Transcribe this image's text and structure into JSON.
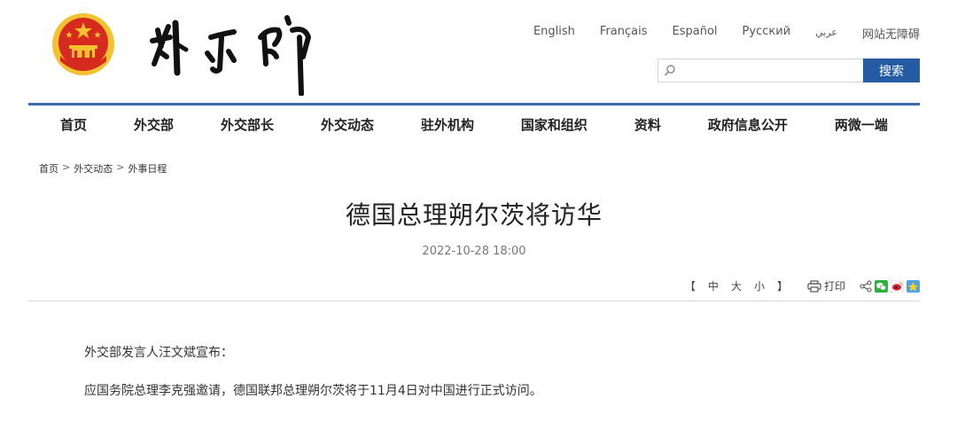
{
  "header": {
    "languages": [
      "English",
      "Français",
      "Español",
      "Русский",
      "عربي",
      "网站无障碍"
    ],
    "search": {
      "placeholder": "",
      "button_label": "搜索"
    }
  },
  "nav": {
    "items": [
      "首页",
      "外交部",
      "外交部长",
      "外交动态",
      "驻外机构",
      "国家和组织",
      "资料",
      "政府信息公开",
      "两微一端"
    ]
  },
  "breadcrumb": {
    "items": [
      "首页",
      "外交动态",
      "外事日程"
    ],
    "separator": ">"
  },
  "article": {
    "title": "德国总理朔尔茨将访华",
    "date": "2022-10-28 18:00",
    "paragraphs": [
      "外交部发言人汪文斌宣布：",
      "应国务院总理李克强邀请，德国联邦总理朔尔茨将于11月4日对中国进行正式访问。"
    ]
  },
  "tools": {
    "font_open": "【",
    "font_sizes": [
      "中",
      "大",
      "小"
    ],
    "font_close": "】",
    "print_label": "打印"
  },
  "colors": {
    "brand_blue": "#245ba3",
    "nav_border": "#3d6bb0",
    "emblem_red": "#d62a1e",
    "emblem_gold": "#f2c230"
  }
}
